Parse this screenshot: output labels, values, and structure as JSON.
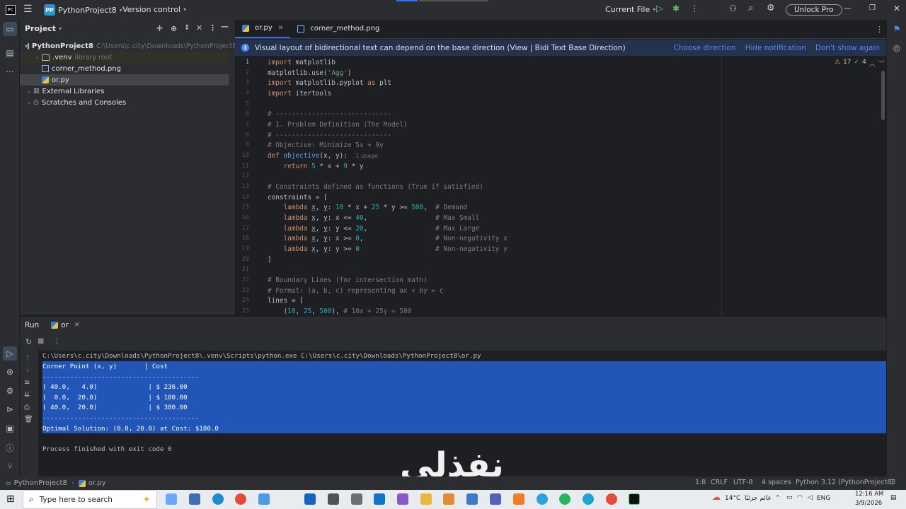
{
  "titlebar": {
    "project_badge": "PP",
    "project_name": "PythonProject8",
    "vcs": "Version control",
    "run_config": "Current File",
    "unlock": "Unlock Pro"
  },
  "project_panel": {
    "title": "Project",
    "items": [
      {
        "label": "PythonProject8",
        "path": "C:\\Users\\c.city\\Downloads\\PythonProject8"
      },
      {
        "label": ".venv",
        "path": "library root"
      },
      {
        "label": "corner_method.png",
        "path": ""
      },
      {
        "label": "or.py",
        "path": ""
      },
      {
        "label": "External Libraries",
        "path": ""
      },
      {
        "label": "Scratches and Consoles",
        "path": ""
      }
    ]
  },
  "editor": {
    "tabs": [
      {
        "label": "or.py"
      },
      {
        "label": "corner_method.png"
      }
    ],
    "notification": {
      "text": "Visual layout of bidirectional text can depend on the base direction (View | Bidi Text Base Direction)",
      "actions": [
        "Choose direction",
        "Hide notification",
        "Don't show again"
      ]
    },
    "inspections": {
      "warnings": "17",
      "ok": "4"
    },
    "line_numbers": [
      "1",
      "2",
      "3",
      "4",
      "5",
      "6",
      "7",
      "8",
      "9",
      "10",
      "11",
      "12",
      "13",
      "14",
      "15",
      "16",
      "17",
      "18",
      "19",
      "20",
      "21",
      "22",
      "23",
      "24",
      "25"
    ],
    "lines": {
      "l1a": "import",
      "l1b": " matplotlib",
      "l2a": "matplotlib.use(",
      "l2b": "'Agg'",
      "l2c": ")",
      "l3a": "import",
      "l3b": " matplotlib.pyplot ",
      "l3c": "as",
      "l3d": " plt",
      "l4a": "import",
      "l4b": " itertools",
      "l6": "# -----------------------------",
      "l7": "# 1. Problem Definition (The Model)",
      "l8": "# -----------------------------",
      "l9": "# Objective: Minimize 5x + 9y",
      "l10a": "def",
      "l10b": "objective",
      "l10c": "(x, y):",
      "l10hint": "1 usage",
      "l11a": "    return",
      "l11b": "5",
      "l11c": " * x + ",
      "l11d": "9",
      "l11e": " * y",
      "l13": "# Constraints defined as functions (True if satisfied)",
      "l14": "constraints = [",
      "l15a": "lambda",
      "l15b": "x",
      "l15c": "y",
      "l15d": ": ",
      "l15e": "10",
      "l15f": " * x + ",
      "l15g": "25",
      "l15h": " * y >= ",
      "l15i": "500",
      "l15j": ",  ",
      "l15k": "# Demand",
      "l16a": "lambda",
      "l16b": "x",
      "l16c": "y",
      "l16d": ": x <= ",
      "l16e": "40",
      "l16f": ",",
      "l16k": "# Max Small",
      "l17a": "lambda",
      "l17b": "x",
      "l17c": "y",
      "l17d": ": y <= ",
      "l17e": "20",
      "l17f": ",",
      "l17k": "# Max Large",
      "l18a": "lambda",
      "l18b": "x",
      "l18c": "y",
      "l18d": ": x >= ",
      "l18e": "0",
      "l18f": ",",
      "l18k": "# Non-negativity x",
      "l19a": "lambda",
      "l19b": "x",
      "l19c": "y",
      "l19d": ": y >= ",
      "l19e": "0",
      "l19k": "# Non-negativity y",
      "l20": "]",
      "l22": "# Boundary Lines (for intersection math)",
      "l23": "# Format: (a, b, c) representing ax + by = c",
      "l24": "lines = [",
      "l25a": "    (",
      "l25b": "10",
      "l25c": ", ",
      "l25d": "25",
      "l25e": ", ",
      "l25f": "500",
      "l25g": "), ",
      "l25h": "# 10x + 25y = 500"
    }
  },
  "run_panel": {
    "tab_run": "Run",
    "tab_config": "or",
    "console": {
      "cmd": "C:\\Users\\c.city\\Downloads\\PythonProject8\\.venv\\Scripts\\python.exe C:\\Users\\c.city\\Downloads\\PythonProject8\\or.py",
      "header": "Corner Point (x, y)       | Cost",
      "sep": "----------------------------------------",
      "row1": "( 40.0,   4.0)             | $ 236.00",
      "row2": "(  0.0,  20.0)             | $ 180.00",
      "row3": "( 40.0,  20.0)             | $ 380.00",
      "sep2": "----------------------------------------",
      "optimal": "Optimal Solution: (0.0, 20.0) at Cost: $180.0",
      "exit": "Process finished with exit code 0"
    }
  },
  "watermark": "نفذلي",
  "statusbar": {
    "project": "PythonProject8",
    "file": "or.py",
    "position": "1:8",
    "line_sep": "CRLF",
    "encoding": "UTF-8",
    "indent": "4 spaces",
    "interpreter": "Python 3.12 (PythonProject8)"
  },
  "taskbar": {
    "search_placeholder": "Type here to search",
    "weather": "14°C",
    "weather_text": "غائم جزئيًا",
    "lang": "ENG",
    "time": "12:16 AM",
    "date": "3/9/2026"
  },
  "colors": {
    "accent": "#3574f0",
    "selection": "#2255b8",
    "keyword": "#cf8e6d",
    "string": "#6aab73",
    "number": "#2aacb8",
    "comment": "#7a7e85"
  }
}
